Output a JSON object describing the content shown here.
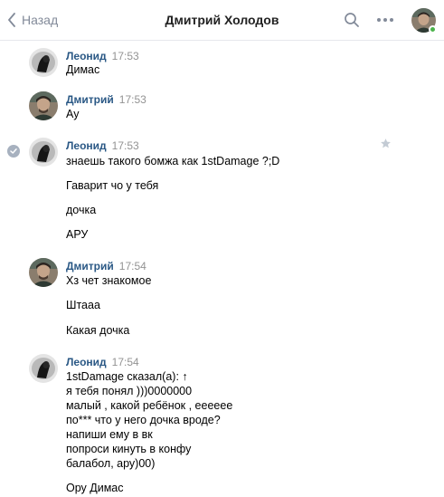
{
  "header": {
    "back_label": "Назад",
    "title": "Дмитрий Холодов",
    "icons": [
      "chevron-left-icon",
      "search-icon",
      "more-icon",
      "avatar"
    ]
  },
  "messages": [
    {
      "author": "Леонид",
      "time": "17:53",
      "lines": [
        "Димас"
      ]
    },
    {
      "author": "Дмитрий",
      "time": "17:53",
      "lines": [
        "Ау"
      ]
    },
    {
      "author": "Леонид",
      "time": "17:53",
      "lines": [
        "знаешь такого бомжа как 1stDamage ?;D",
        "Гаварит чо у тебя",
        "дочка",
        "АРУ"
      ]
    },
    {
      "author": "Дмитрий",
      "time": "17:54",
      "lines": [
        "Хз чет знакомое",
        "Штааа",
        "Какая дочка"
      ]
    },
    {
      "author": "Леонид",
      "time": "17:54",
      "lines": [
        "1stDamage сказал(а): ↑",
        "я тебя понял )))0000000",
        "малый , какой ребёнок , ееееее",
        "по*** что у него дочка вроде?",
        "напиши ему в вк",
        "попроси кинуть в конфу",
        "балабол, ару)00)",
        "Ору Димас"
      ]
    }
  ],
  "colors": {
    "author": "#2a5885",
    "time": "#939393",
    "back": "#828a99",
    "online": "#4bb34b",
    "selected_check": "#a7b1bf",
    "star": "#c3cbd4"
  }
}
